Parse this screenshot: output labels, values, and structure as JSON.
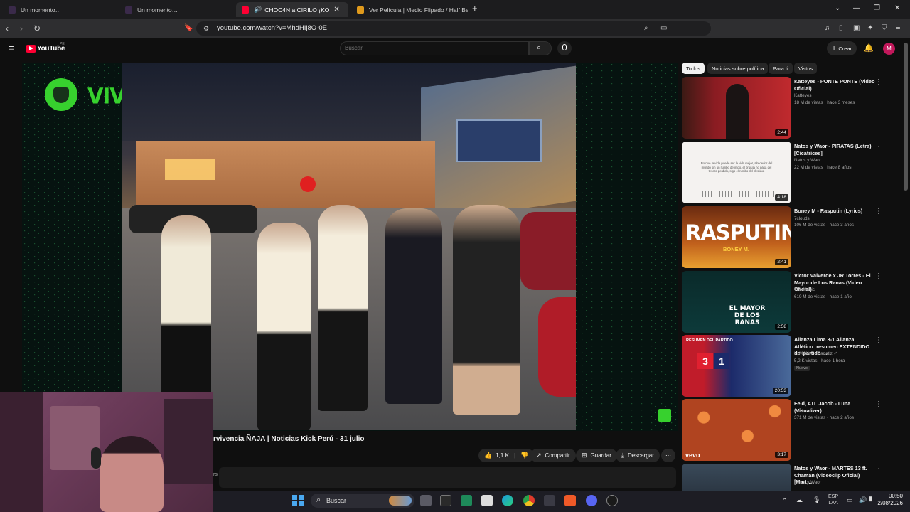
{
  "tabs": [
    {
      "label": "Un momento…"
    },
    {
      "label": "Un momento…"
    },
    {
      "label": "CHOC4N a CIRILO ¡KO"
    },
    {
      "label": "Ver Película | Medio Flipado / Half Be"
    }
  ],
  "address": {
    "url": "youtube.com/watch?v=MhdHIj8O-0E"
  },
  "youtube": {
    "logo_text": "YouTube",
    "logo_sup": "PE",
    "search_placeholder": "Buscar",
    "create_label": "Crear",
    "avatar_letter": "M"
  },
  "player": {
    "stream_brand": "VIVOXELSTREAMING",
    "video_title": "rvivencia ÑAJA | Noticias Kick Perú - 31 julio",
    "actions": {
      "likes": "1,1 K",
      "share": "Compartir",
      "save": "Guardar",
      "download": "Descargar"
    },
    "desc_fragment": "rs"
  },
  "filters": [
    "Todos",
    "Noticias sobre política",
    "Para ti",
    "Vistos"
  ],
  "recommendations": [
    {
      "title": "Katteyes - PONTE PONTE (Video Oficial)",
      "channel": "Katteyes",
      "meta": "18 M de vistas · hace 3 meses",
      "duration": "2:44",
      "thumb_color": "#8a1c22"
    },
    {
      "title": "Natos y Waor - PIRATAS (Letra) [Cicatrices]",
      "channel": "Natos y Waor",
      "meta": "22 M de vistas · hace 8 años",
      "duration": "4:18",
      "thumb_color": "#f4f2f0",
      "thumb_text": "Porque la vida puede ser la vida mejor, alrededor del mundo sin un rumbo definido, el brújula no pasa del tesoro perdido, sigo el rumbo del destino."
    },
    {
      "title": "Boney M - Rasputin (Lyrics)",
      "channel": "7clouds",
      "meta": "106 M de vistas · hace 3 años",
      "duration": "2:41",
      "thumb_color": "#c0601c",
      "thumb_text": "RASPUTIN",
      "thumb_sub": "BONEY M."
    },
    {
      "title": "Victor Valverde x JR Torres - El Mayor de Los Ranas (Video Oficial)",
      "channel": "Vim Music",
      "meta": "619 M de vistas · hace 1 año",
      "duration": "2:58",
      "thumb_color": "#0d3a3a",
      "thumb_text": "EL MAYOR DE LOS RANAS"
    },
    {
      "title": "Alianza Lima 3-1 Alianza Atlético: resumen EXTENDIDO del partido …",
      "channel": "L1MAX",
      "channel_extra": "Fanatiz",
      "meta": "5,2 K vistas · hace 1 hora",
      "badge": "Nuevo",
      "duration": "20:53",
      "thumb_color": "#2a3b8a",
      "thumb_text": "RESUMEN DEL PARTIDO",
      "score_home": "3",
      "score_away": "1"
    },
    {
      "title": "Feid, ATL Jacob - Luna (Visualizer)",
      "channel": "Feid",
      "meta": "371 M de vistas · hace 2 años",
      "duration": "3:17",
      "thumb_color": "#d0582a",
      "thumb_text": "vevo"
    },
    {
      "title": "Natos y Waor - MARTES 13 ft. Chaman (Videoclip Oficial) [Mart…",
      "channel": "Natos y Waor",
      "meta": "",
      "duration": "",
      "thumb_color": "#3a4a5a"
    }
  ],
  "taskbar": {
    "search_label": "Buscar",
    "lang_top": "ESP",
    "lang_bottom": "LAA",
    "time": "00:50",
    "date": "2/08/2026"
  },
  "colors": {
    "accent_green": "#37d12e",
    "youtube_red": "#ff0033",
    "avatar_purple": "#c2185b"
  }
}
